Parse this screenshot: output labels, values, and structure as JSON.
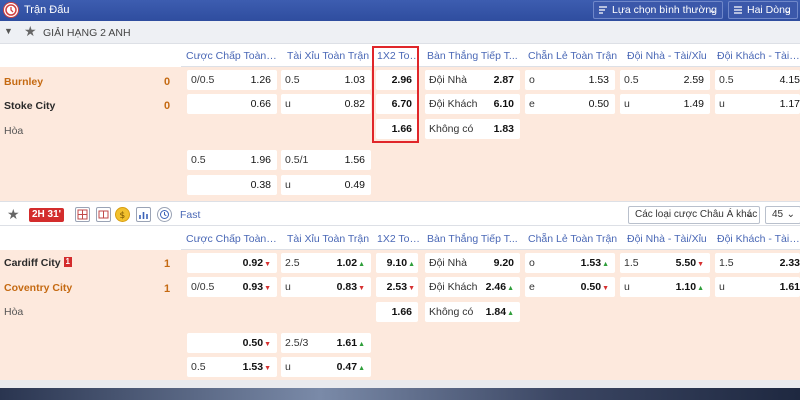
{
  "topbar": {
    "title": "Trận Đấu",
    "sort_label": "Lựa chọn bình thường",
    "lines_label": "Hai Dòng"
  },
  "league": {
    "name": "GIẢI HẠNG 2 ANH"
  },
  "columns": [
    "Cược Chấp Toàn T...",
    "Tài Xỉu Toàn Trận",
    "1X2 Toà...",
    "Bàn Thắng Tiếp T...",
    "Chẵn Lẻ Toàn Trận",
    "Đội Nhà - Tài/Xỉu",
    "Đội Khách - Tài/Xỉu"
  ],
  "match1": {
    "home": "Burnley",
    "away": "Stoke City",
    "draw": "Hòa",
    "home_score": "0",
    "away_score": "0",
    "hdp": [
      [
        "0/0.5",
        "1.26"
      ],
      [
        "",
        "0.66"
      ]
    ],
    "ou": [
      [
        "0.5",
        "1.03"
      ],
      [
        "u",
        "0.82"
      ]
    ],
    "x12": [
      "2.96",
      "6.70",
      "1.66"
    ],
    "next": [
      [
        "Đội Nhà",
        "2.87"
      ],
      [
        "Đội Khách",
        "6.10"
      ],
      [
        "Không có",
        "1.83"
      ]
    ],
    "oe": [
      [
        "o",
        "1.53"
      ],
      [
        "e",
        "0.50"
      ]
    ],
    "home_ou": [
      [
        "0.5",
        "2.59"
      ],
      [
        "u",
        "1.49"
      ]
    ],
    "away_ou": [
      [
        "0.5",
        "4.15"
      ],
      [
        "u",
        "1.17"
      ]
    ],
    "extra_hdp": [
      [
        "0.5",
        "1.96"
      ],
      [
        "",
        "0.38"
      ]
    ],
    "extra_ou": [
      [
        "0.5/1",
        "1.56"
      ],
      [
        "u",
        "0.49"
      ]
    ]
  },
  "matchbar": {
    "live": "2H 31'",
    "fast": "Fast",
    "bet_type": "Các loại cược Châu Á khác",
    "count": "45"
  },
  "match2": {
    "home": "Cardiff City",
    "red_cards": "1",
    "away": "Coventry City",
    "draw": "Hòa",
    "home_score": "1",
    "away_score": "1",
    "hdp": [
      [
        "",
        "0.92"
      ],
      [
        "0/0.5",
        "0.93"
      ]
    ],
    "ou": [
      [
        "2.5",
        "1.02"
      ],
      [
        "u",
        "0.83"
      ]
    ],
    "x12": [
      "9.10",
      "2.53",
      "1.66"
    ],
    "next": [
      [
        "Đội Nhà",
        "9.20"
      ],
      [
        "Đội Khách",
        "2.46"
      ],
      [
        "Không có",
        "1.84"
      ]
    ],
    "oe": [
      [
        "o",
        "1.53"
      ],
      [
        "e",
        "0.50"
      ]
    ],
    "home_ou": [
      [
        "1.5",
        "5.50"
      ],
      [
        "u",
        "1.10"
      ]
    ],
    "away_ou": [
      [
        "1.5",
        "2.33"
      ],
      [
        "u",
        "1.61"
      ]
    ],
    "extra_hdp": [
      [
        "",
        "0.50"
      ],
      [
        "0.5",
        "1.53"
      ]
    ],
    "extra_ou": [
      [
        "2.5/3",
        "1.61"
      ],
      [
        "u",
        "0.47"
      ]
    ]
  }
}
